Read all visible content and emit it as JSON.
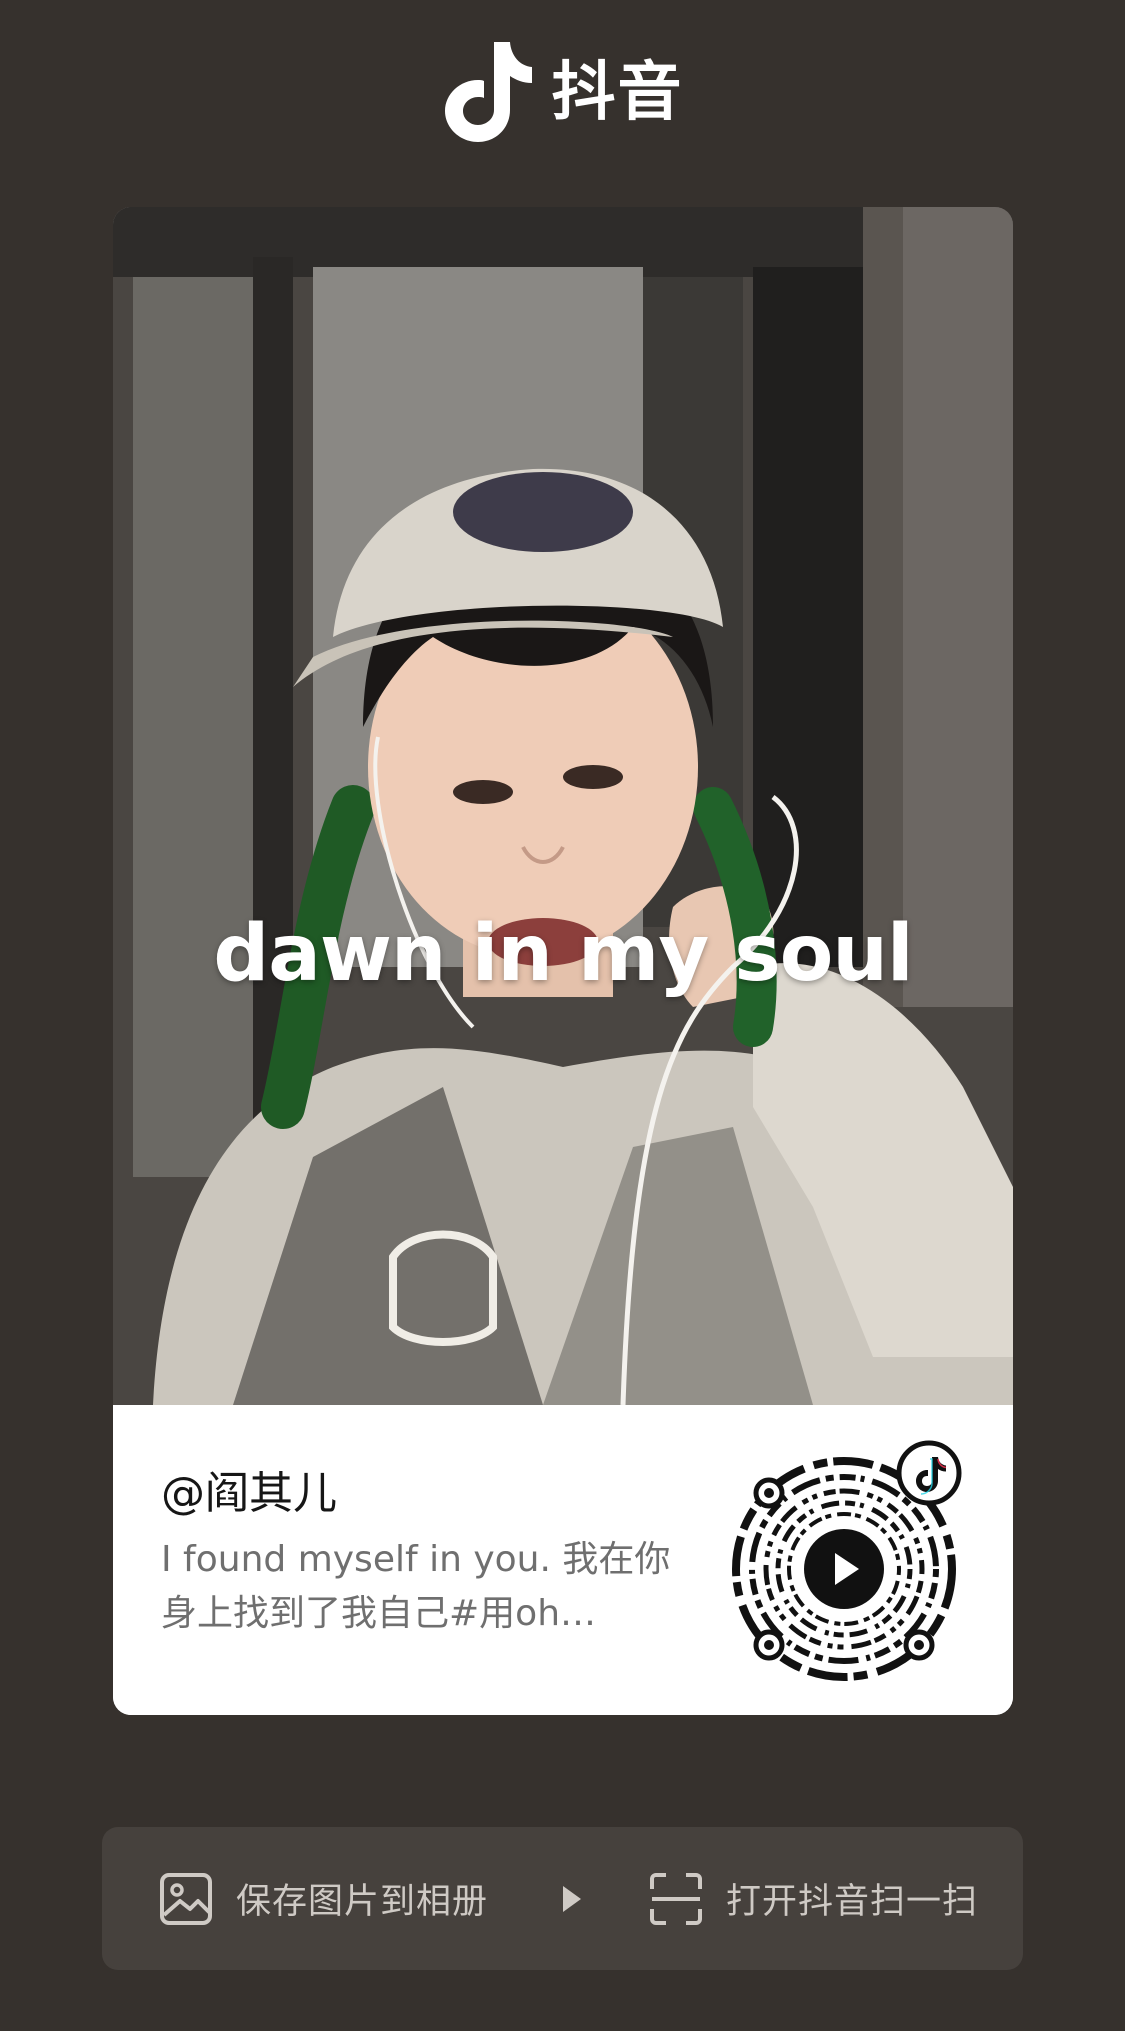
{
  "header": {
    "app_name": "抖音",
    "logo_icon": "douyin-note-icon"
  },
  "card": {
    "cover_caption": "dawn in my soul",
    "author": "@阎其儿",
    "description": "I found myself in you. 我在你身上找到了我自己#用oh…",
    "qr_icon": "douyin-qr-code",
    "qr_badge_icon": "douyin-note-icon",
    "qr_center_icon": "play-icon"
  },
  "actions": {
    "save_label": "保存图片到相册",
    "save_icon": "image-icon",
    "separator_icon": "triangle-right-icon",
    "scan_label": "打开抖音扫一扫",
    "scan_icon": "scan-icon"
  },
  "colors": {
    "background": "#36312d",
    "action_bar": "#46413d",
    "card": "#ffffff",
    "author_text": "#161616",
    "desc_text": "#6f6f6f"
  }
}
